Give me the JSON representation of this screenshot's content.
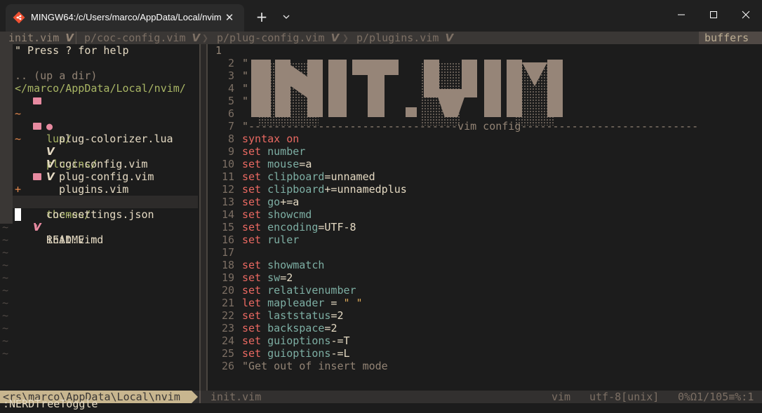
{
  "window": {
    "tab_title": "MINGW64:/c/Users/marco/AppData/Local/nvim",
    "tab_icon": "git-bash-icon",
    "close_glyph": "✕",
    "new_tab_glyph": "+"
  },
  "tabline": {
    "active": "init.vim",
    "tabs": [
      "p/coc-config.vim",
      "p/plug-config.vim",
      "p/plugins.vim"
    ],
    "buffers_label": "buffers"
  },
  "nerdtree": {
    "help": "\" Press ? for help",
    "up_dir": ".. (up a dir)",
    "root": "</marco/AppData/Local/nvim/",
    "entries": [
      {
        "mark": "~",
        "indent": 1,
        "type": "folder",
        "name": "lua/"
      },
      {
        "mark": "",
        "indent": 2,
        "type": "lua",
        "name": "plug-colorizer.lua"
      },
      {
        "mark": "~",
        "indent": 1,
        "type": "folder",
        "name": "plugins/"
      },
      {
        "mark": "",
        "indent": 2,
        "type": "vim",
        "name": "coc-config.vim"
      },
      {
        "mark": "",
        "indent": 2,
        "type": "vim",
        "name": "plug-config.vim"
      },
      {
        "mark": "",
        "indent": 2,
        "type": "vim",
        "name": "plugins.vim"
      },
      {
        "mark": "+",
        "indent": 1,
        "type": "folder",
        "name": "themes/"
      },
      {
        "mark": "",
        "indent": 1,
        "type": "json",
        "name": "coc-settings.json"
      },
      {
        "mark": "",
        "indent": 1,
        "type": "vim",
        "name": "init.vim"
      },
      {
        "mark": "",
        "indent": 1,
        "type": "md",
        "name": "README.md"
      }
    ],
    "tilde": "~"
  },
  "code": {
    "first_line_number": "1",
    "ascii_banner_text": "INIT.VIM",
    "lines": [
      {
        "n": "2",
        "text": "\""
      },
      {
        "n": "3",
        "text": "\""
      },
      {
        "n": "4",
        "text": "\""
      },
      {
        "n": "5",
        "text": "\""
      },
      {
        "n": "6",
        "text": ""
      },
      {
        "n": "7",
        "text": "\"---------------------------------vim config----------------------------"
      },
      {
        "n": "8",
        "kw": "syntax",
        "opt": "on"
      },
      {
        "n": "9",
        "kw": "set",
        "opt": "number"
      },
      {
        "n": "10",
        "kw": "set",
        "opt": "mouse",
        "op": "=",
        "val": "a"
      },
      {
        "n": "11",
        "kw": "set",
        "opt": "clipboard",
        "op": "=",
        "val": "unnamed"
      },
      {
        "n": "12",
        "kw": "set",
        "opt": "clipboard",
        "op": "+=",
        "val": "unnamedplus"
      },
      {
        "n": "13",
        "kw": "set",
        "opt": "go",
        "op": "+=",
        "val": "a"
      },
      {
        "n": "14",
        "kw": "set",
        "opt": "showcmd"
      },
      {
        "n": "15",
        "kw": "set",
        "opt": "encoding",
        "op": "=",
        "val": "UTF-8"
      },
      {
        "n": "16",
        "kw": "set",
        "opt": "ruler"
      },
      {
        "n": "17",
        "text": ""
      },
      {
        "n": "18",
        "kw": "set",
        "opt": "showmatch"
      },
      {
        "n": "19",
        "kw": "set",
        "opt": "sw",
        "op": "=",
        "val": "2"
      },
      {
        "n": "20",
        "kw": "set",
        "opt": "relativenumber"
      },
      {
        "n": "21",
        "kw": "let",
        "opt": "mapleader",
        "op": " = ",
        "str": "\" \""
      },
      {
        "n": "22",
        "kw": "set",
        "opt": "laststatus",
        "op": "=",
        "val": "2"
      },
      {
        "n": "23",
        "kw": "set",
        "opt": "backspace",
        "op": "=",
        "val": "2"
      },
      {
        "n": "24",
        "kw": "set",
        "opt": "guioptions",
        "op": "-=",
        "val": "T"
      },
      {
        "n": "25",
        "kw": "set",
        "opt": "guioptions",
        "op": "-=",
        "val": "L"
      },
      {
        "n": "26",
        "text": "\"Get out of insert mode"
      }
    ]
  },
  "statusline": {
    "left": "<rs\\marco\\AppData\\Local\\nvim",
    "file": "init.vim",
    "filetype": "vim",
    "encoding": "utf-8[unix]",
    "position": "0%Ω1/105≡%:1"
  },
  "cmdline": ":NERDTreeToggle",
  "colors": {
    "background": "#1c1c1c",
    "keyword": "#ea6962",
    "option": "#7daea3",
    "folder": "#a9b665",
    "comment": "#928374",
    "status_accent": "#c8b68f"
  }
}
